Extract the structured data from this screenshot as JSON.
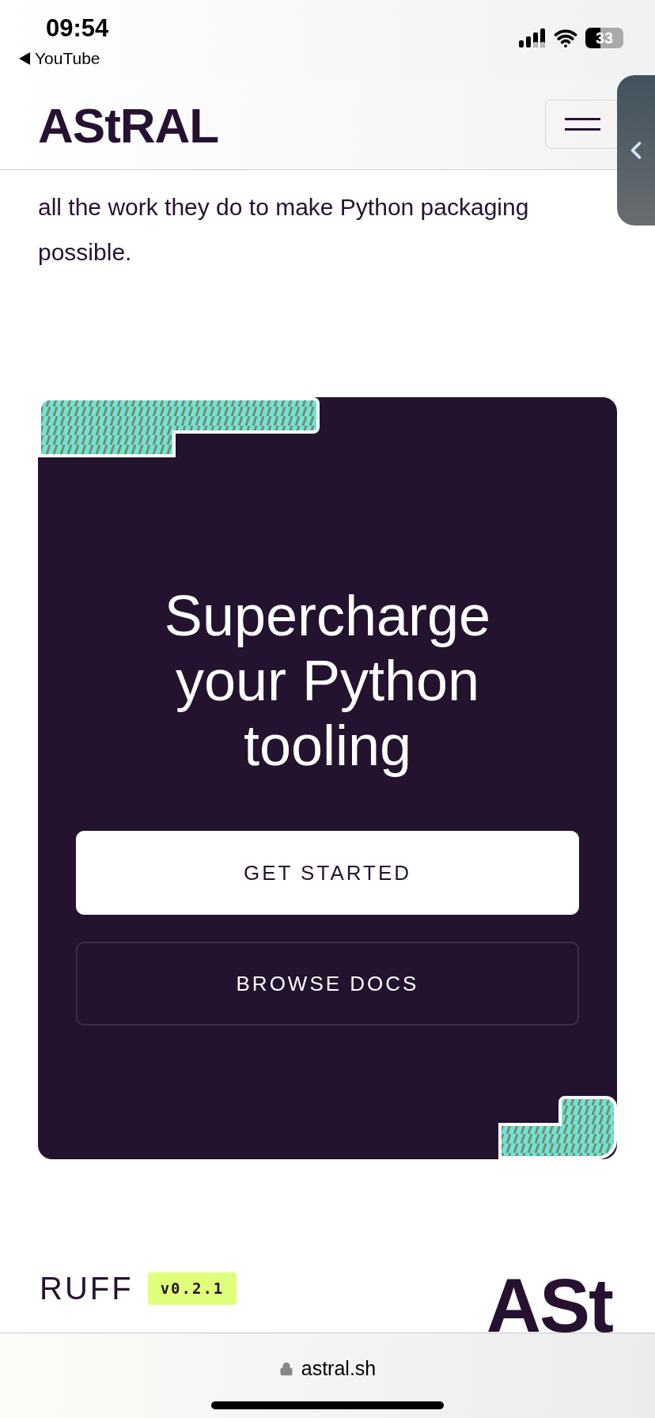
{
  "status_bar": {
    "time": "09:54",
    "back_app": "YouTube",
    "battery": "33"
  },
  "header": {
    "logo": "AStRAL"
  },
  "paragraph": "all the work they do to make Python packaging possible.",
  "cta": {
    "title": "Supercharge your Python tooling",
    "buttons": [
      {
        "label": "GET STARTED",
        "kind": "primary"
      },
      {
        "label": "BROWSE DOCS",
        "kind": "outline"
      }
    ]
  },
  "product": {
    "name": "RUFF",
    "version": "v0.2.1",
    "logo": "ASt"
  },
  "address_bar": {
    "url": "astral.sh"
  }
}
